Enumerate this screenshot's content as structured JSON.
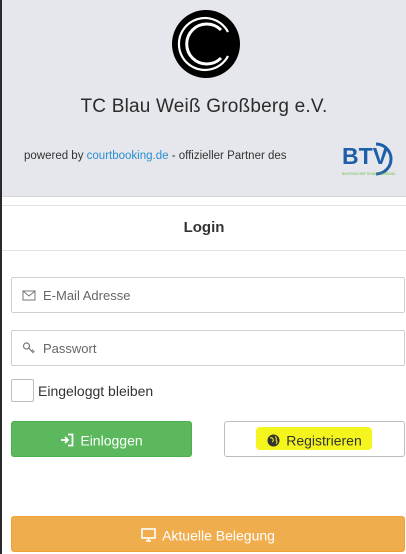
{
  "header": {
    "club_name": "TC Blau Weiß Großberg e.V.",
    "powered_prefix": "powered by ",
    "powered_link": "courtbooking.de",
    "powered_suffix": " - offizieller Partner des",
    "partner_logo_text": "BTV",
    "partner_logo_subtext": "BAYERISCHER TENNIS-VERBAND"
  },
  "login": {
    "title": "Login",
    "email_placeholder": "E-Mail Adresse",
    "password_placeholder": "Passwort",
    "remember_label": "Eingeloggt bleiben",
    "login_button": "Einloggen",
    "register_button": "Registrieren"
  },
  "footer": {
    "belegung_button": "Aktuelle Belegung"
  },
  "icons": {
    "email": "envelope-icon",
    "password": "key-icon",
    "login": "sign-in-icon",
    "register": "globe-icon",
    "belegung": "monitor-icon"
  },
  "colors": {
    "header_bg": "#e5e7ec",
    "link": "#2a8fcf",
    "success": "#5cb85c",
    "warning": "#f0ad4e",
    "highlight": "#f5f51e",
    "btv_blue": "#1d5fa8",
    "btv_green": "#6abf4b"
  }
}
